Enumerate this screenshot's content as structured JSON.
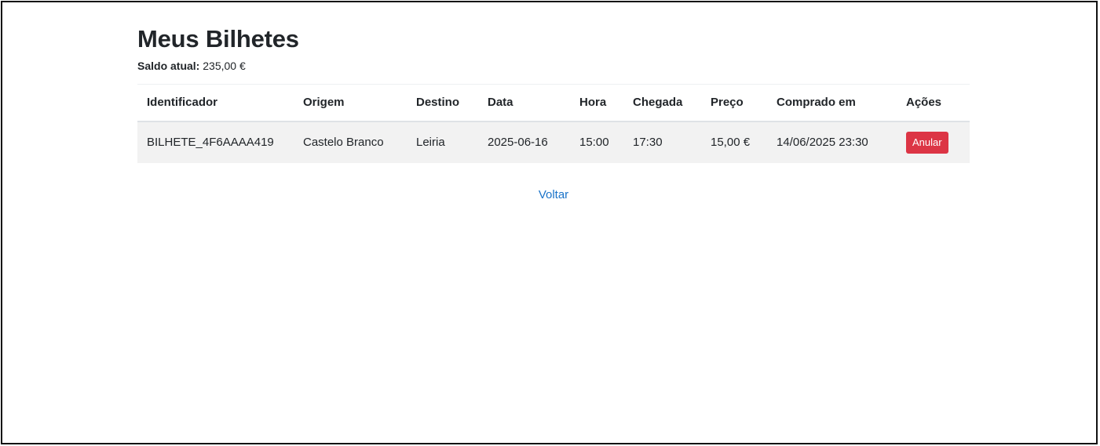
{
  "page": {
    "title": "Meus Bilhetes",
    "balance_label": "Saldo atual:",
    "balance_value": "235,00 €"
  },
  "table": {
    "headers": [
      "Identificador",
      "Origem",
      "Destino",
      "Data",
      "Hora",
      "Chegada",
      "Preço",
      "Comprado em",
      "Ações"
    ],
    "rows": [
      {
        "id": "BILHETE_4F6AAAA419",
        "origin": "Castelo Branco",
        "destination": "Leiria",
        "date": "2025-06-16",
        "time": "15:00",
        "arrival": "17:30",
        "price": "15,00 €",
        "purchased_at": "14/06/2025 23:30",
        "action_label": "Anular"
      }
    ]
  },
  "nav": {
    "back_label": "Voltar"
  },
  "colors": {
    "danger": "#dc3545",
    "link": "#1a73c9",
    "row_bg": "#f2f2f2"
  }
}
